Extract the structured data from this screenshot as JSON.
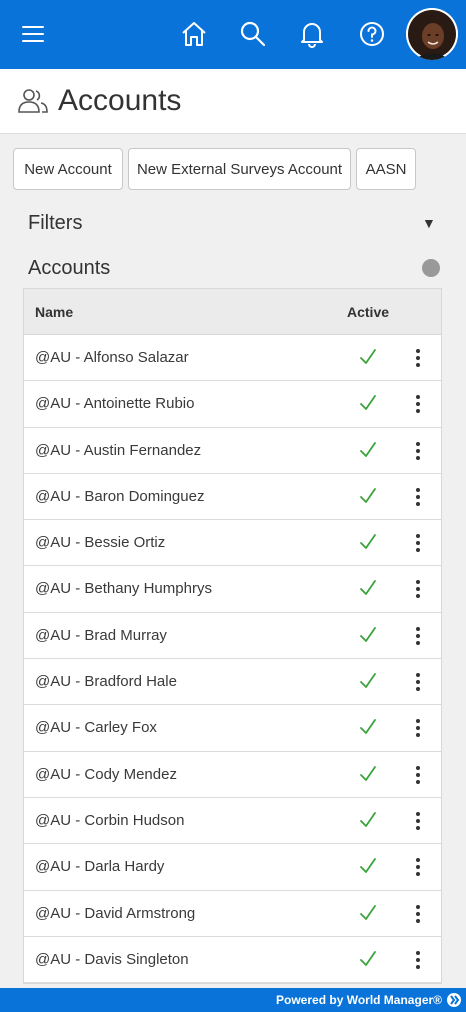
{
  "header": {
    "title": "Accounts"
  },
  "buttons": {
    "new_account": "New Account",
    "new_external": "New External Surveys Account",
    "aasn": "AASN"
  },
  "filters": {
    "label": "Filters",
    "caret": "▼"
  },
  "accounts_section": {
    "label": "Accounts"
  },
  "table": {
    "columns": {
      "name": "Name",
      "active": "Active"
    },
    "rows": [
      {
        "name": "@AU - Alfonso Salazar",
        "active": true
      },
      {
        "name": "@AU - Antoinette Rubio",
        "active": true
      },
      {
        "name": "@AU - Austin Fernandez",
        "active": true
      },
      {
        "name": "@AU - Baron Dominguez",
        "active": true
      },
      {
        "name": "@AU - Bessie Ortiz",
        "active": true
      },
      {
        "name": "@AU - Bethany Humphrys",
        "active": true
      },
      {
        "name": "@AU - Brad Murray",
        "active": true
      },
      {
        "name": "@AU - Bradford Hale",
        "active": true
      },
      {
        "name": "@AU - Carley Fox",
        "active": true
      },
      {
        "name": "@AU - Cody Mendez",
        "active": true
      },
      {
        "name": "@AU - Corbin Hudson",
        "active": true
      },
      {
        "name": "@AU - Darla Hardy",
        "active": true
      },
      {
        "name": "@AU - David Armstrong",
        "active": true
      },
      {
        "name": "@AU - Davis Singleton",
        "active": true
      }
    ]
  },
  "footer": {
    "text": "Powered by World Manager®"
  },
  "colors": {
    "brand": "#0a73d9",
    "check": "#3aa33a"
  }
}
